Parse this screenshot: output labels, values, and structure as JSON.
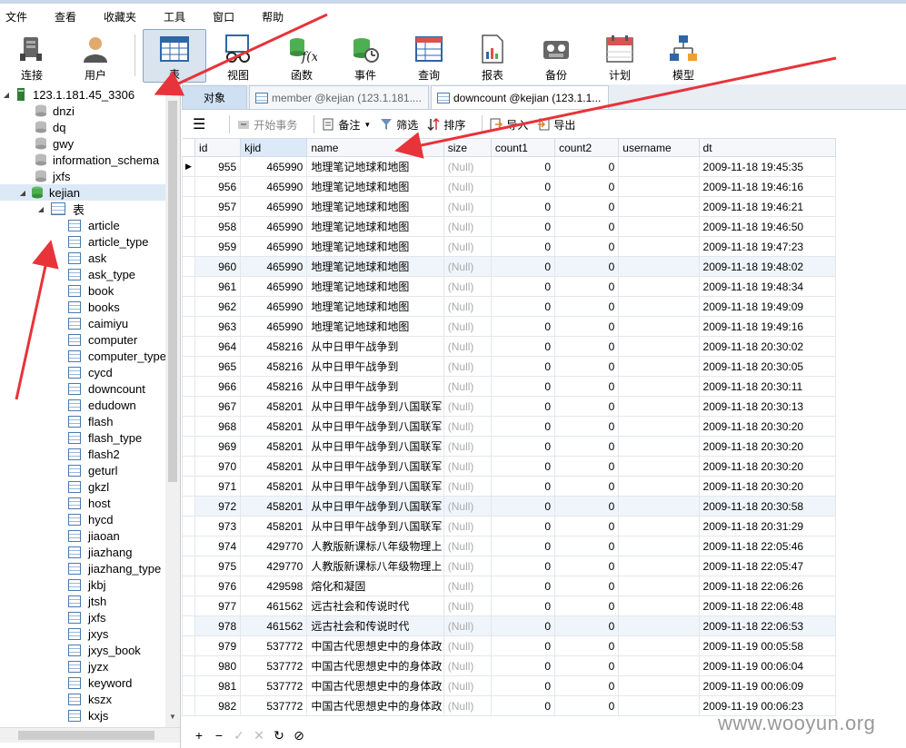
{
  "menu": [
    "文件",
    "查看",
    "收藏夹",
    "工具",
    "窗口",
    "帮助"
  ],
  "toolbar": [
    {
      "label": "连接",
      "icon": "plug-icon"
    },
    {
      "label": "用户",
      "icon": "user-icon"
    },
    {
      "label": "表",
      "icon": "table-icon",
      "active": true
    },
    {
      "label": "视图",
      "icon": "view-icon"
    },
    {
      "label": "函数",
      "icon": "function-icon"
    },
    {
      "label": "事件",
      "icon": "event-icon"
    },
    {
      "label": "查询",
      "icon": "query-icon"
    },
    {
      "label": "报表",
      "icon": "report-icon"
    },
    {
      "label": "备份",
      "icon": "backup-icon"
    },
    {
      "label": "计划",
      "icon": "schedule-icon"
    },
    {
      "label": "模型",
      "icon": "model-icon"
    }
  ],
  "tree": {
    "connection": "123.1.181.45_3306",
    "databases": [
      "dnzi",
      "dq",
      "gwy",
      "information_schema",
      "jxfs"
    ],
    "open_db": "kejian",
    "tables_label": "表",
    "tables": [
      "article",
      "article_type",
      "ask",
      "ask_type",
      "book",
      "books",
      "caimiyu",
      "computer",
      "computer_type",
      "cycd",
      "downcount",
      "edudown",
      "flash",
      "flash_type",
      "flash2",
      "geturl",
      "gkzl",
      "host",
      "hycd",
      "jiaoan",
      "jiazhang",
      "jiazhang_type",
      "jkbj",
      "jtsh",
      "jxfs",
      "jxys",
      "jxys_book",
      "jyzx",
      "keyword",
      "kszx",
      "kxjs"
    ]
  },
  "tabs": {
    "objects": "对象",
    "tab1": "member @kejian (123.1.181....",
    "tab2": "downcount @kejian (123.1.1..."
  },
  "gridtool": {
    "begin_tx": "开始事务",
    "memo": "备注",
    "filter": "筛选",
    "sort": "排序",
    "import": "导入",
    "export": "导出"
  },
  "columns": [
    "id",
    "kjid",
    "name",
    "size",
    "count1",
    "count2",
    "username",
    "dt"
  ],
  "null_text": "(Null)",
  "rows": [
    [
      "955",
      "465990",
      "地理笔记地球和地图",
      "0",
      "0",
      "2009-11-18 19:45:35"
    ],
    [
      "956",
      "465990",
      "地理笔记地球和地图",
      "0",
      "0",
      "2009-11-18 19:46:16"
    ],
    [
      "957",
      "465990",
      "地理笔记地球和地图",
      "0",
      "0",
      "2009-11-18 19:46:21"
    ],
    [
      "958",
      "465990",
      "地理笔记地球和地图",
      "0",
      "0",
      "2009-11-18 19:46:50"
    ],
    [
      "959",
      "465990",
      "地理笔记地球和地图",
      "0",
      "0",
      "2009-11-18 19:47:23"
    ],
    [
      "960",
      "465990",
      "地理笔记地球和地图",
      "0",
      "0",
      "2009-11-18 19:48:02"
    ],
    [
      "961",
      "465990",
      "地理笔记地球和地图",
      "0",
      "0",
      "2009-11-18 19:48:34"
    ],
    [
      "962",
      "465990",
      "地理笔记地球和地图",
      "0",
      "0",
      "2009-11-18 19:49:09"
    ],
    [
      "963",
      "465990",
      "地理笔记地球和地图",
      "0",
      "0",
      "2009-11-18 19:49:16"
    ],
    [
      "964",
      "458216",
      "从中日甲午战争到",
      "0",
      "0",
      "2009-11-18 20:30:02"
    ],
    [
      "965",
      "458216",
      "从中日甲午战争到",
      "0",
      "0",
      "2009-11-18 20:30:05"
    ],
    [
      "966",
      "458216",
      "从中日甲午战争到",
      "0",
      "0",
      "2009-11-18 20:30:11"
    ],
    [
      "967",
      "458201",
      "从中日甲午战争到八国联军",
      "0",
      "0",
      "2009-11-18 20:30:13"
    ],
    [
      "968",
      "458201",
      "从中日甲午战争到八国联军",
      "0",
      "0",
      "2009-11-18 20:30:20"
    ],
    [
      "969",
      "458201",
      "从中日甲午战争到八国联军",
      "0",
      "0",
      "2009-11-18 20:30:20"
    ],
    [
      "970",
      "458201",
      "从中日甲午战争到八国联军",
      "0",
      "0",
      "2009-11-18 20:30:20"
    ],
    [
      "971",
      "458201",
      "从中日甲午战争到八国联军",
      "0",
      "0",
      "2009-11-18 20:30:20"
    ],
    [
      "972",
      "458201",
      "从中日甲午战争到八国联军",
      "0",
      "0",
      "2009-11-18 20:30:58"
    ],
    [
      "973",
      "458201",
      "从中日甲午战争到八国联军",
      "0",
      "0",
      "2009-11-18 20:31:29"
    ],
    [
      "974",
      "429770",
      "人教版新课标八年级物理上",
      "0",
      "0",
      "2009-11-18 22:05:46"
    ],
    [
      "975",
      "429770",
      "人教版新课标八年级物理上",
      "0",
      "0",
      "2009-11-18 22:05:47"
    ],
    [
      "976",
      "429598",
      "熔化和凝固",
      "0",
      "0",
      "2009-11-18 22:06:26"
    ],
    [
      "977",
      "461562",
      "远古社会和传说时代",
      "0",
      "0",
      "2009-11-18 22:06:48"
    ],
    [
      "978",
      "461562",
      "远古社会和传说时代",
      "0",
      "0",
      "2009-11-18 22:06:53"
    ],
    [
      "979",
      "537772",
      "中国古代思想史中的身体政",
      "0",
      "0",
      "2009-11-19 00:05:58"
    ],
    [
      "980",
      "537772",
      "中国古代思想史中的身体政",
      "0",
      "0",
      "2009-11-19 00:06:04"
    ],
    [
      "981",
      "537772",
      "中国古代思想史中的身体政",
      "0",
      "0",
      "2009-11-19 00:06:09"
    ],
    [
      "982",
      "537772",
      "中国古代思想史中的身体政",
      "0",
      "0",
      "2009-11-19 00:06:23"
    ]
  ],
  "bottom": {
    "add": "+",
    "remove": "−",
    "apply": "✓",
    "cancel": "✕",
    "refresh": "↻",
    "stop": "⊘"
  },
  "watermark": "www.wooyun.org",
  "colors": {
    "accent": "#dce9f7",
    "arrow": "#e8333a",
    "db_green": "#4caf50"
  }
}
